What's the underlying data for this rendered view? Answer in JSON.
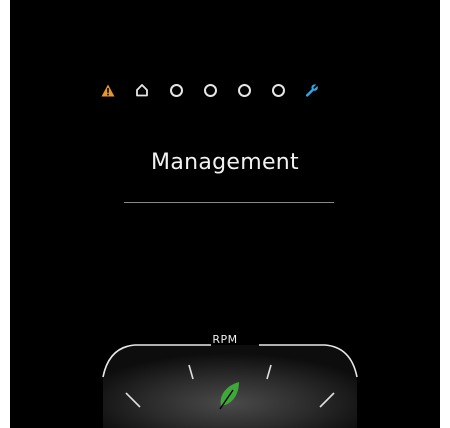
{
  "status_bar": {
    "icons": [
      {
        "name": "warning-icon",
        "color": "#e8952c"
      },
      {
        "name": "home-icon",
        "color": "#e6e6e6"
      },
      {
        "name": "dot-icon",
        "color": "#e6e6e6"
      },
      {
        "name": "dot-icon",
        "color": "#e6e6e6"
      },
      {
        "name": "dot-icon",
        "color": "#e6e6e6"
      },
      {
        "name": "dot-icon",
        "color": "#e6e6e6"
      },
      {
        "name": "wrench-icon",
        "color": "#2fa8e8"
      }
    ]
  },
  "main": {
    "title": "Management"
  },
  "gauge": {
    "label": "RPM",
    "eco_icon": "leaf-icon",
    "eco_color": "#3fa83a"
  },
  "colors": {
    "background": "#000000",
    "text": "#f2f2f2",
    "warning": "#e8952c",
    "accent": "#2fa8e8",
    "eco": "#3fa83a"
  }
}
